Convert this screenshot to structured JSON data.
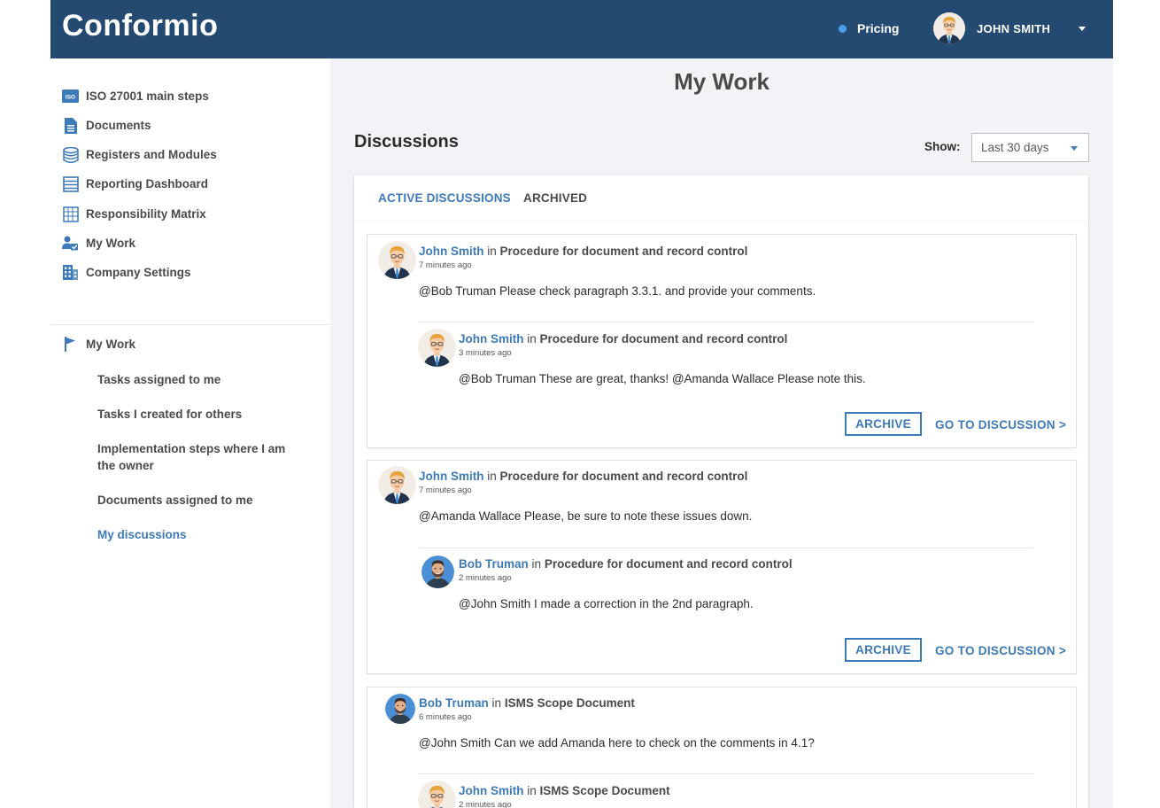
{
  "header": {
    "logo": "Conformio",
    "pricing_label": "Pricing",
    "user_name": "JOHN SMITH"
  },
  "sidebar": {
    "items": [
      {
        "label": "ISO 27001 main steps",
        "icon": "iso-badge-icon"
      },
      {
        "label": "Documents",
        "icon": "document-icon"
      },
      {
        "label": "Registers and Modules",
        "icon": "database-icon"
      },
      {
        "label": "Reporting Dashboard",
        "icon": "list-icon"
      },
      {
        "label": "Responsibility Matrix",
        "icon": "grid-icon"
      },
      {
        "label": "My Work",
        "icon": "user-check-icon"
      },
      {
        "label": "Company Settings",
        "icon": "building-icon"
      }
    ],
    "section": {
      "label": "My Work",
      "icon": "flag-icon"
    },
    "sub_items": [
      {
        "label": "Tasks assigned to me"
      },
      {
        "label": "Tasks I created for others"
      },
      {
        "label": "Implementation steps where I am the owner"
      },
      {
        "label": "Documents assigned to me"
      },
      {
        "label": "My discussions",
        "active": true
      }
    ]
  },
  "main": {
    "title": "My Work",
    "discussions_title": "Discussions",
    "show_label": "Show:",
    "show_value": "Last 30 days",
    "tabs": [
      {
        "label": "ACTIVE DISCUSSIONS",
        "active": true
      },
      {
        "label": "ARCHIVED",
        "active": false
      }
    ],
    "in_word": "in",
    "archive_label": "ARCHIVE",
    "goto_label": "GO TO DISCUSSION >",
    "discussions": [
      {
        "comment": {
          "author": "John Smith",
          "doc": "Procedure for document and record control",
          "time": "7 minutes ago",
          "text": "@Bob Truman Please check paragraph 3.3.1. and provide your comments.",
          "avatar": "john"
        },
        "reply": {
          "author": "John Smith",
          "doc": "Procedure for document and record control",
          "time": "3 minutes ago",
          "text": "@Bob Truman These are great, thanks! @Amanda Wallace Please note this.",
          "avatar": "john"
        }
      },
      {
        "comment": {
          "author": "John Smith",
          "doc": "Procedure for document and record control",
          "time": "7 minutes ago",
          "text": "@Amanda Wallace Please, be sure to note these issues down.",
          "avatar": "john"
        },
        "reply": {
          "author": "Bob Truman",
          "doc": "Procedure for document and record control",
          "time": "2 minutes ago",
          "text": "@John Smith I made a correction in the 2nd paragraph.",
          "avatar": "bob"
        }
      },
      {
        "comment": {
          "author": "Bob Truman",
          "doc": "ISMS Scope Document",
          "time": "6 minutes ago",
          "text": "@John Smith Can we add Amanda here to check on the comments in 4.1?",
          "avatar": "bob"
        },
        "reply": {
          "author": "John Smith",
          "doc": "ISMS Scope Document",
          "time": "2 minutes ago",
          "text": "",
          "avatar": "john"
        }
      }
    ]
  },
  "colors": {
    "header_bg": "#254a72",
    "accent": "#3d7ab8",
    "page_bg": "#f2f3f7"
  }
}
